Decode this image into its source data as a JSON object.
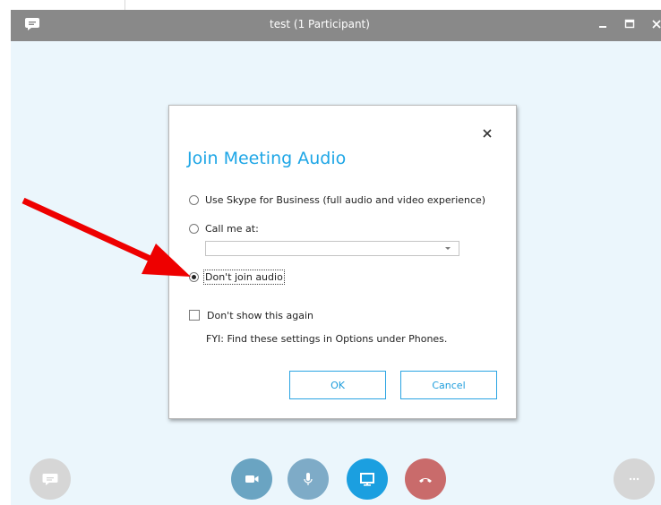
{
  "window": {
    "title": "test (1 Participant)"
  },
  "dialog": {
    "title": "Join Meeting Audio",
    "options": [
      {
        "label": "Use Skype for Business (full audio and video experience)",
        "selected": false
      },
      {
        "label": "Call me at:",
        "selected": false
      },
      {
        "label": "Don't join audio",
        "selected": true
      }
    ],
    "call_me_value": "",
    "dont_show_label": "Don't show this again",
    "dont_show_checked": false,
    "fyi_text": "FYI: Find these settings in Options under Phones.",
    "ok_label": "OK",
    "cancel_label": "Cancel"
  },
  "colors": {
    "titlebar": "#898989",
    "accent": "#1ea6e6",
    "video": "#6aa4c2",
    "mic": "#7eabc7",
    "share": "#1b9fe0",
    "hangup": "#c96b6b",
    "annotation_arrow": "#ee0000"
  },
  "icons": {
    "app": "chat-bubble-icon",
    "chat": "chat-icon",
    "video": "video-camera-icon",
    "mic": "microphone-icon",
    "share": "monitor-icon",
    "hangup": "phone-hangup-icon",
    "more": "more-icon"
  }
}
